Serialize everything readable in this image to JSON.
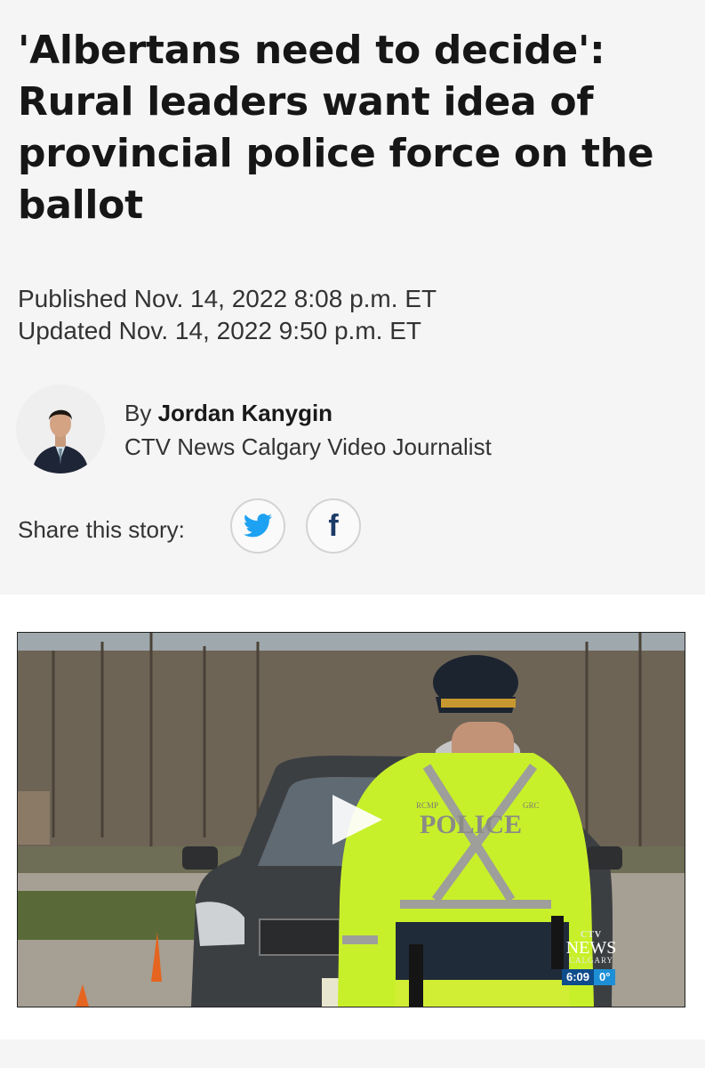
{
  "article": {
    "headline": "'Albertans need to decide': Rural leaders want idea of provincial police force on the ballot",
    "published": "Published Nov. 14, 2022 8:08 p.m. ET",
    "updated": "Updated Nov. 14, 2022 9:50 p.m. ET"
  },
  "author": {
    "by_prefix": "By",
    "name": "Jordan Kanygin",
    "title": "CTV News Calgary Video Journalist"
  },
  "share": {
    "label": "Share this story:",
    "buttons": [
      {
        "service": "twitter",
        "icon": "twitter-bird-icon"
      },
      {
        "service": "facebook",
        "icon": "facebook-f-icon",
        "glyph": "f"
      }
    ]
  },
  "video": {
    "overlay_text": {
      "vest_top_left": "RCMP",
      "vest_top_right": "GRC",
      "vest_label": "POLICE"
    },
    "station_logo": {
      "network": "CTV",
      "word": "NEWS",
      "city": "CALGARY"
    },
    "clock": "6:09",
    "temperature": "0°",
    "play_icon": "play-triangle-icon"
  },
  "colors": {
    "background": "#f5f5f5",
    "vest_yellow": "#c8f02a",
    "twitter_blue": "#1da1f2",
    "facebook_navy": "#1b3a66"
  }
}
